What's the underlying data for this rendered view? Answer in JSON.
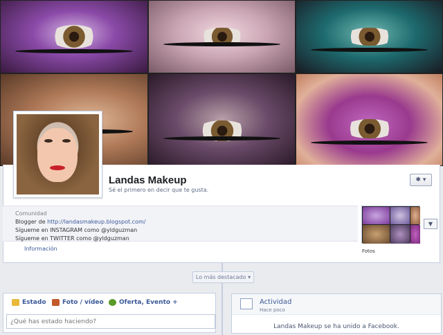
{
  "cover": {
    "tile_colors": [
      "#8a4aa8",
      "#c9a4b2",
      "#1d6a6e",
      "#b07a58",
      "#6a4a68",
      "#9a3a8e"
    ]
  },
  "page": {
    "name": "Landas Makeup",
    "like_prompt": "Sé el primero en decir que te gusta.",
    "settings_label": "✱ ▾"
  },
  "about": {
    "category": "Comunidad",
    "blogger_prefix": "Blogger de ",
    "blogger_link": "http://landasmakeup.blogspot.com/",
    "instagram": "Sígueme en INSTAGRAM como @yldguzman",
    "twitter": "Sígueme en TWITTER como @yldguzman",
    "info_link": "Información"
  },
  "photos": {
    "label": "Fotos",
    "arrow": "▼"
  },
  "timeline": {
    "highlights_label": "Lo más destacado ▾"
  },
  "composer": {
    "tabs": [
      {
        "label": "Estado",
        "icon": "status-icon",
        "color": "#e8b93a"
      },
      {
        "label": "Foto / vídeo",
        "icon": "photo-icon",
        "color": "#c25a2a"
      },
      {
        "label": "Oferta, Evento +",
        "icon": "offer-icon",
        "color": "#5a9a2a"
      }
    ],
    "placeholder": "¿Qué has estado haciendo?"
  },
  "activity": {
    "title": "Actividad",
    "time": "Hace poco",
    "text": "Landas Makeup se ha unido a Facebook."
  },
  "colors": {
    "link": "#3b5998",
    "border": "#c4cde0"
  }
}
